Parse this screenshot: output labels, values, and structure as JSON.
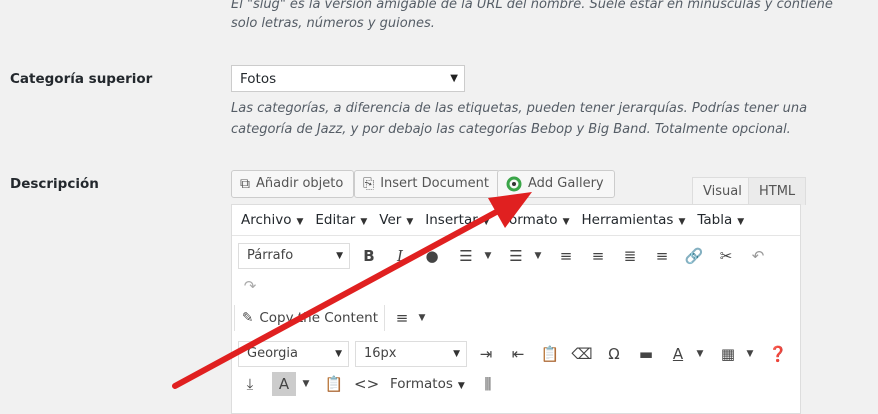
{
  "slug_help": {
    "line1": "El \"slug\" es la versión amigable de la URL del nombre. Suele estar en minúsculas y contiene",
    "line2": "solo letras, números y guiones."
  },
  "parent": {
    "label": "Categoría superior",
    "value": "Fotos",
    "help_line1": "Las categorías, a diferencia de las etiquetas, pueden tener jerarquías. Podrías tener una",
    "help_line2": "categoría de Jazz, y por debajo las categorías Bebop y Big Band. Totalmente opcional."
  },
  "description": {
    "label": "Descripción",
    "buttons": {
      "add_media": "Añadir objeto",
      "insert_document": "Insert Document",
      "add_gallery": "Add Gallery"
    },
    "tabs": {
      "visual": "Visual",
      "html": "HTML"
    }
  },
  "menubar": [
    "Archivo",
    "Editar",
    "Ver",
    "Insertar",
    "Formato",
    "Herramientas",
    "Tabla"
  ],
  "toolbar": {
    "format_select": "Párrafo",
    "copy_content": "Copy the Content",
    "font_family": "Georgia",
    "font_size": "16px",
    "formats": "Formatos"
  },
  "colors": {
    "arrow": "#e02020",
    "gallery_icon": "#3aa548"
  }
}
